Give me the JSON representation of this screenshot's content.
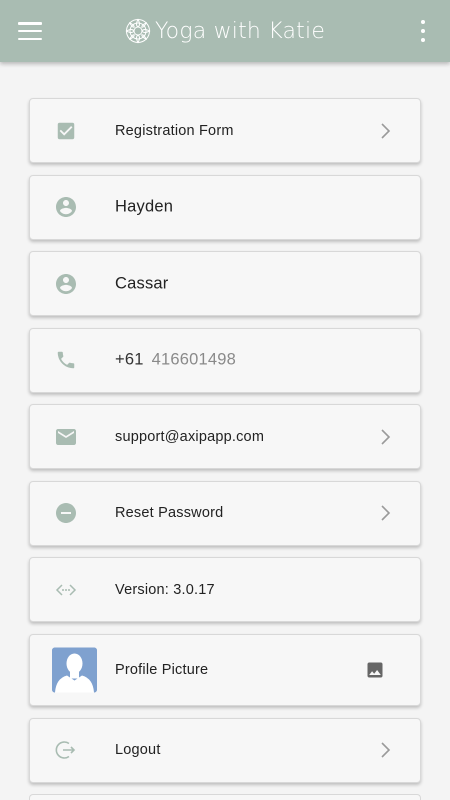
{
  "app": {
    "title": "Yoga with Katie",
    "header_color": "#a9bcb2",
    "icon_color": "#a9bcb2"
  },
  "items": [
    {
      "label": "Registration Form",
      "icon": "checkbox-icon"
    },
    {
      "label": "Hayden",
      "icon": "account-circle-icon"
    },
    {
      "label": "Cassar",
      "icon": "account-circle-icon"
    },
    {
      "phone_prefix": "+61",
      "phone_number": "416601498",
      "icon": "phone-icon"
    },
    {
      "label": "support@axipapp.com",
      "icon": "email-icon"
    },
    {
      "label": "Reset Password",
      "icon": "minus-circle-icon"
    },
    {
      "label": "Version: 3.0.17",
      "icon": "code-icon"
    },
    {
      "label": "Profile Picture",
      "icon": "avatar-placeholder"
    },
    {
      "label": "Logout",
      "icon": "logout-icon"
    }
  ]
}
